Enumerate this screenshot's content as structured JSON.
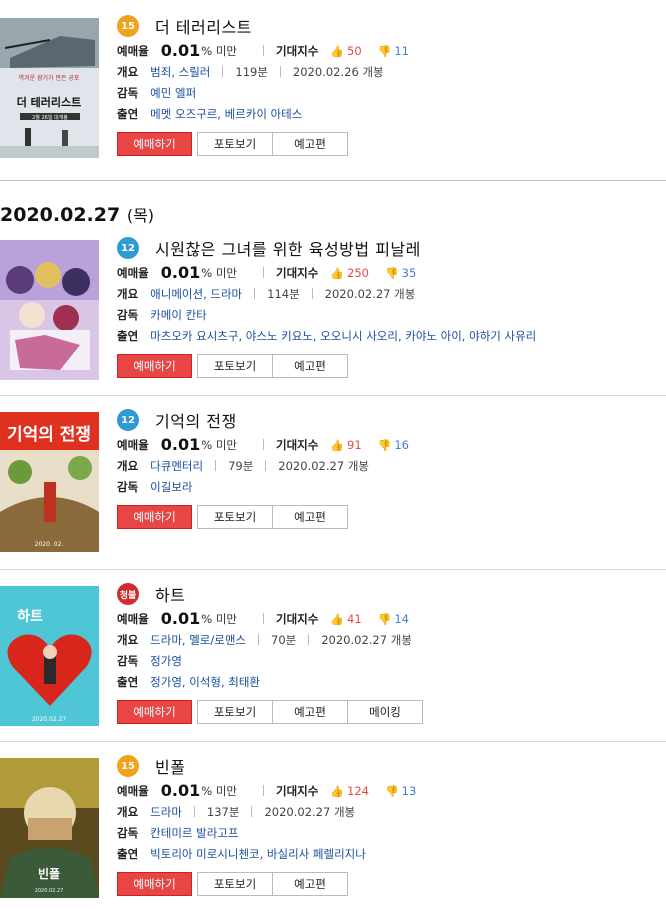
{
  "labels": {
    "rate": "예매율",
    "rate_suffix": "% 미만",
    "expect": "기대지수",
    "overview": "개요",
    "director": "감독",
    "cast": "출연",
    "release_suffix": "개봉"
  },
  "date_header": {
    "date": "2020.02.27",
    "dow": "(목)"
  },
  "buttons": {
    "book": "예매하기",
    "photo": "포토보기",
    "trailer": "예고편",
    "making": "메이킹"
  },
  "movies": [
    {
      "rating": "15",
      "title": "더 테러리스트",
      "rate": "0.01",
      "like": "50",
      "dislike": "11",
      "genre": "범죄, 스릴러",
      "runtime": "119분",
      "release": "2020.02.26",
      "director": "예민 엘퍼",
      "cast": "메멧 오즈구르, 베르카이 아테스",
      "poster_text": "더 테러리스트",
      "poster_sub": "역겨운 광기가 만든 공포",
      "poster_date": "2월 26일 대개봉"
    },
    {
      "rating": "12",
      "title": "시원찮은 그녀를 위한 육성방법 피날레",
      "rate": "0.01",
      "like": "250",
      "dislike": "35",
      "genre": "애니메이션, 드라마",
      "runtime": "114분",
      "release": "2020.02.27",
      "director": "카메이 칸타",
      "cast": "마츠오카 요시츠구, 야스노 키요노, 오오니시 사오리, 카야노 아이, 야하기 사유리"
    },
    {
      "rating": "12",
      "title": "기억의 전쟁",
      "rate": "0.01",
      "like": "91",
      "dislike": "16",
      "genre": "다큐멘터리",
      "runtime": "79분",
      "release": "2020.02.27",
      "director": "이길보라",
      "poster_text": "기억의 전쟁",
      "poster_date": "2020. 02."
    },
    {
      "rating": "청불",
      "title": "하트",
      "rate": "0.01",
      "like": "41",
      "dislike": "14",
      "genre": "드라마, 멜로/로맨스",
      "runtime": "70분",
      "release": "2020.02.27",
      "director": "정가영",
      "cast": "정가영, 이석형, 최태환",
      "poster_text": "하트",
      "poster_date": "2020.02.27"
    },
    {
      "rating": "15",
      "title": "빈폴",
      "rate": "0.01",
      "like": "124",
      "dislike": "13",
      "genre": "드라마",
      "runtime": "137분",
      "release": "2020.02.27",
      "director": "칸테미르 발라고프",
      "cast": "빅토리아 미로시니첸코, 바실리사 페렐리지나",
      "poster_text": "빈폴",
      "poster_date": "2020.02.27"
    }
  ],
  "colors": {
    "book_button": "#e84545",
    "like": "#e34a4a",
    "dislike": "#3f7fd6",
    "rating15": "#f0a31a",
    "rating12": "#2e9ad7",
    "rating_adult": "#d22b2b"
  }
}
